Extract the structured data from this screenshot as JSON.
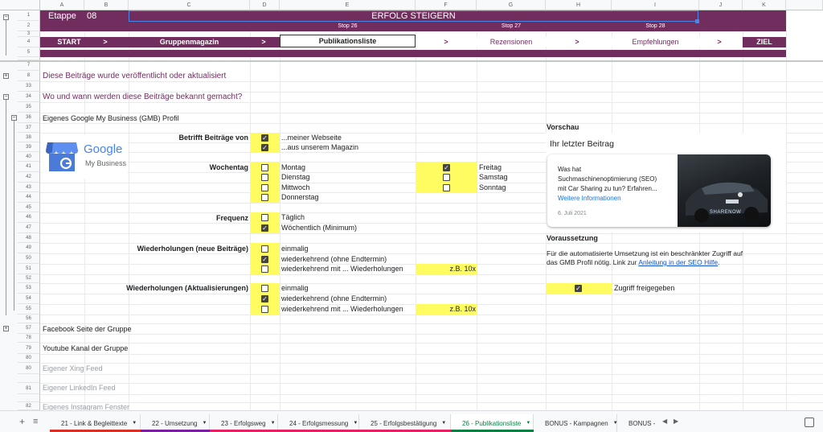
{
  "columns": [
    "A",
    "B",
    "C",
    "D",
    "E",
    "F",
    "G",
    "H",
    "I",
    "J",
    "K"
  ],
  "rows": [
    "1",
    "2",
    "3",
    "4",
    "5",
    "6",
    "7",
    "8",
    "33",
    "34",
    "35",
    "36",
    "37",
    "38",
    "39",
    "40",
    "41",
    "42",
    "43",
    "44",
    "45",
    "46",
    "47",
    "48",
    "49",
    "50",
    "51",
    "52",
    "53",
    "54",
    "55",
    "56",
    "57",
    "78",
    "79",
    "80",
    "81",
    "82"
  ],
  "banner": {
    "etappe_label": "Etappe",
    "etappe_num": "08",
    "title": "ERFOLG STEIGERN",
    "stop26": "Stop 26",
    "stop27": "Stop 27",
    "stop28": "Stop 28",
    "start": "START",
    "arrow": ">",
    "gruppenmagazin": "Gruppenmagazin",
    "publikationsliste": "Publikationsliste",
    "rezensionen": "Rezensionen",
    "empfehlungen": "Empfehlungen",
    "ziel": "ZIEL"
  },
  "sections": {
    "s8": "Diese Beiträge wurde veröffentlicht oder aktualisiert",
    "s34": "Wo und wann werden diese Beiträge bekannt gemacht?",
    "s36": "Eigenes Google My Business (GMB) Profil",
    "s57": "Facebook Seite der Gruppe",
    "s79": "Youtube Kanal der Gruppe",
    "s80": "Eigener Xing Feed",
    "s81": "Eigener LinkedIn Feed",
    "s82": "Eigenes Instagram Fenster"
  },
  "logo": {
    "google": "Google",
    "mybusiness": "My Business"
  },
  "form": {
    "betrifft_label": "Betrifft Beiträge von",
    "betrifft": [
      {
        "text": "...meiner Webseite",
        "checked": true
      },
      {
        "text": "...aus unserem Magazin",
        "checked": true
      }
    ],
    "wochentag_label": "Wochentag",
    "days_left": [
      {
        "text": "Montag",
        "checked": false
      },
      {
        "text": "Dienstag",
        "checked": false
      },
      {
        "text": "Mittwoch",
        "checked": false
      },
      {
        "text": "Donnerstag",
        "checked": false
      }
    ],
    "days_right": [
      {
        "text": "Freitag",
        "checked": true
      },
      {
        "text": "Samstag",
        "checked": false
      },
      {
        "text": "Sonntag",
        "checked": false
      }
    ],
    "frequenz_label": "Frequenz",
    "frequenz": [
      {
        "text": "Täglich",
        "checked": false
      },
      {
        "text": "Wöchentlich (Minimum)",
        "checked": true
      }
    ],
    "wdh_neu_label": "Wiederholungen (neue Beiträge)",
    "wdh_neu": [
      {
        "text": "einmalig",
        "checked": false
      },
      {
        "text": "wiederkehrend (ohne Endtermin)",
        "checked": true
      },
      {
        "text": "wiederkehrend mit ... Wiederholungen",
        "checked": false
      }
    ],
    "wdh_neu_example": "z.B. 10x",
    "wdh_akt_label": "Wiederholungen (Aktualisierungen)",
    "wdh_akt": [
      {
        "text": "einmalig",
        "checked": false
      },
      {
        "text": "wiederkehrend (ohne Endtermin)",
        "checked": true
      },
      {
        "text": "wiederkehrend mit ... Wiederholungen",
        "checked": false
      }
    ],
    "wdh_akt_example": "z.B. 10x"
  },
  "preview": {
    "heading": "Vorschau",
    "card_title": "Ihr letzter Beitrag",
    "line1": "Was hat",
    "line2": "Suchmaschinenoptimierung (SEO)",
    "line3": "mit Car Sharing zu tun? Erfahren...",
    "link": "Weitere Informationen",
    "date": "6. Juli 2021",
    "image_brand": "SHARENOW"
  },
  "voraussetzung": {
    "heading": "Voraussetzung",
    "text1": "Für die automatisierte Umsetzung ist ein beschränkter Zugriff auf",
    "text2_prefix": "das GMB Profil nötig. Link zur ",
    "text2_link": "Anleitung in der SEO Hilfe",
    "text2_suffix": ".",
    "zugriff": "Zugriff freigegeben",
    "zugriff_checked": true
  },
  "tabs": [
    "21 - Link & Begleittexte",
    "22 - Umsetzung",
    "23 - Erfolgsweg",
    "24 - Erfolgsmessung",
    "25 - Erfolgsbestätigung",
    "26 - Publikationsliste",
    "BONUS - Kampagnen",
    "BONUS - R"
  ],
  "tab_active_index": 5,
  "tab_accents": [
    "#d93025",
    "#7b1fa2",
    "#e91e63",
    "#e91e63",
    "#e91e63",
    "#0b8043",
    "#ffffff",
    "#ffffff"
  ],
  "colors": {
    "band": "#722d5f",
    "highlight": "#fffc62"
  }
}
